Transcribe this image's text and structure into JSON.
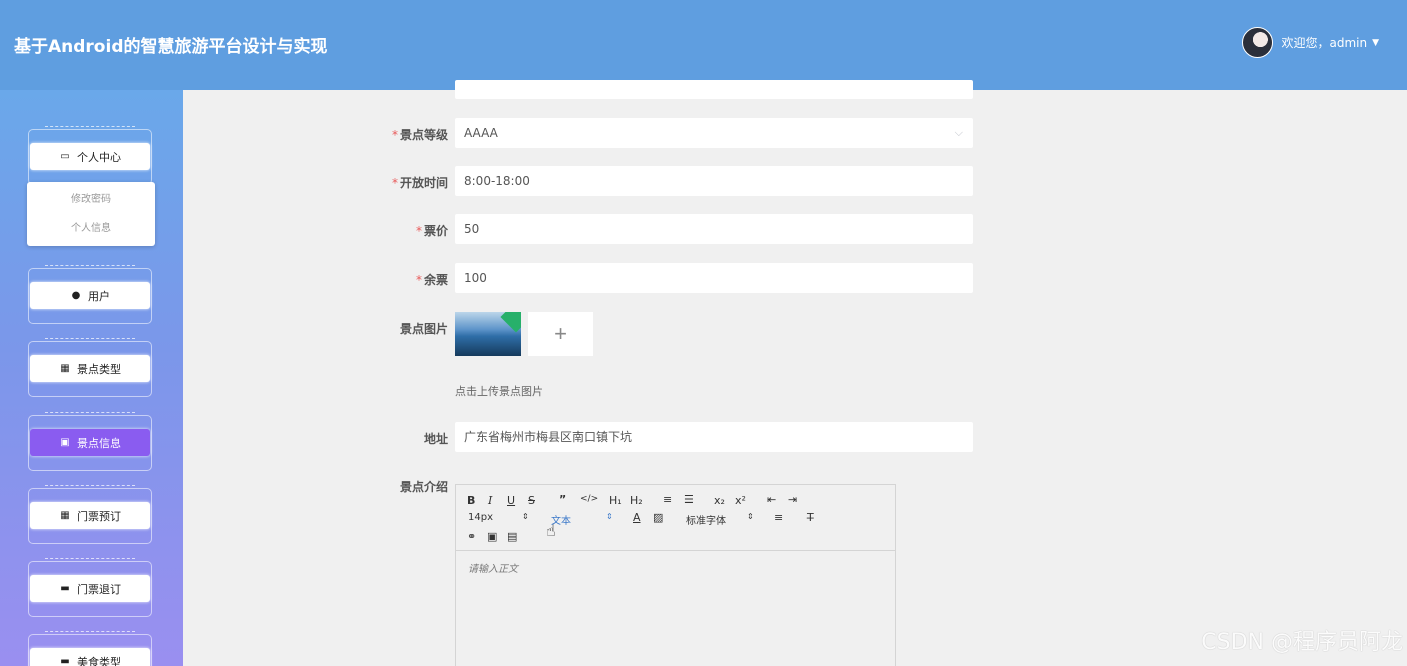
{
  "header": {
    "title": "基于Android的智慧旅游平台设计与实现",
    "welcome": "欢迎您，admin"
  },
  "sidebar": {
    "items": [
      {
        "label": "个人中心",
        "icon": "calendar-icon",
        "glyph": "▭"
      },
      {
        "label": "用户",
        "icon": "location-pin-icon",
        "glyph": "●"
      },
      {
        "label": "景点类型",
        "icon": "grid-icon",
        "glyph": "▦"
      },
      {
        "label": "景点信息",
        "icon": "clipboard-icon",
        "glyph": "▣"
      },
      {
        "label": "门票预订",
        "icon": "grid-icon",
        "glyph": "▦"
      },
      {
        "label": "门票退订",
        "icon": "chat-icon",
        "glyph": "▬"
      },
      {
        "label": "美食类型",
        "icon": "briefcase-icon",
        "glyph": "▬"
      }
    ],
    "submenu": [
      "修改密码",
      "个人信息"
    ]
  },
  "form": {
    "level": {
      "label": "景点等级",
      "value": "AAAA"
    },
    "open_time": {
      "label": "开放时间",
      "value": "8:00-18:00"
    },
    "price": {
      "label": "票价",
      "value": "50"
    },
    "stock": {
      "label": "余票",
      "value": "100"
    },
    "image": {
      "label": "景点图片",
      "hint": "点击上传景点图片",
      "add": "+"
    },
    "address": {
      "label": "地址",
      "value": "广东省梅州市梅县区南口镇下坑"
    },
    "intro": {
      "label": "景点介绍",
      "placeholder": "请输入正文"
    }
  },
  "editor": {
    "font_size": "14px",
    "text_style": "文本",
    "font_family": "标准字体",
    "h1": "H₁",
    "h2": "H₂",
    "sub": "x₂",
    "sup": "x²"
  },
  "watermark": "CSDN @程序员阿龙"
}
